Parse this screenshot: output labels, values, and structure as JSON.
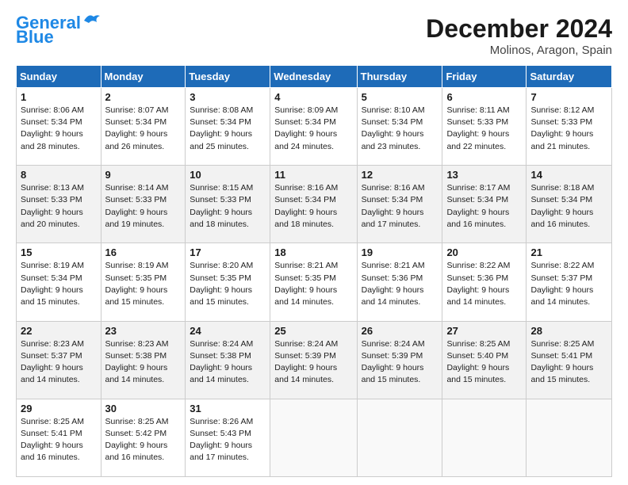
{
  "header": {
    "logo_line1": "General",
    "logo_line2": "Blue",
    "month_title": "December 2024",
    "location": "Molinos, Aragon, Spain"
  },
  "weekdays": [
    "Sunday",
    "Monday",
    "Tuesday",
    "Wednesday",
    "Thursday",
    "Friday",
    "Saturday"
  ],
  "weeks": [
    [
      {
        "day": "1",
        "sunrise": "8:06 AM",
        "sunset": "5:34 PM",
        "daylight": "9 hours and 28 minutes."
      },
      {
        "day": "2",
        "sunrise": "8:07 AM",
        "sunset": "5:34 PM",
        "daylight": "9 hours and 26 minutes."
      },
      {
        "day": "3",
        "sunrise": "8:08 AM",
        "sunset": "5:34 PM",
        "daylight": "9 hours and 25 minutes."
      },
      {
        "day": "4",
        "sunrise": "8:09 AM",
        "sunset": "5:34 PM",
        "daylight": "9 hours and 24 minutes."
      },
      {
        "day": "5",
        "sunrise": "8:10 AM",
        "sunset": "5:34 PM",
        "daylight": "9 hours and 23 minutes."
      },
      {
        "day": "6",
        "sunrise": "8:11 AM",
        "sunset": "5:33 PM",
        "daylight": "9 hours and 22 minutes."
      },
      {
        "day": "7",
        "sunrise": "8:12 AM",
        "sunset": "5:33 PM",
        "daylight": "9 hours and 21 minutes."
      }
    ],
    [
      {
        "day": "8",
        "sunrise": "8:13 AM",
        "sunset": "5:33 PM",
        "daylight": "9 hours and 20 minutes."
      },
      {
        "day": "9",
        "sunrise": "8:14 AM",
        "sunset": "5:33 PM",
        "daylight": "9 hours and 19 minutes."
      },
      {
        "day": "10",
        "sunrise": "8:15 AM",
        "sunset": "5:33 PM",
        "daylight": "9 hours and 18 minutes."
      },
      {
        "day": "11",
        "sunrise": "8:16 AM",
        "sunset": "5:34 PM",
        "daylight": "9 hours and 18 minutes."
      },
      {
        "day": "12",
        "sunrise": "8:16 AM",
        "sunset": "5:34 PM",
        "daylight": "9 hours and 17 minutes."
      },
      {
        "day": "13",
        "sunrise": "8:17 AM",
        "sunset": "5:34 PM",
        "daylight": "9 hours and 16 minutes."
      },
      {
        "day": "14",
        "sunrise": "8:18 AM",
        "sunset": "5:34 PM",
        "daylight": "9 hours and 16 minutes."
      }
    ],
    [
      {
        "day": "15",
        "sunrise": "8:19 AM",
        "sunset": "5:34 PM",
        "daylight": "9 hours and 15 minutes."
      },
      {
        "day": "16",
        "sunrise": "8:19 AM",
        "sunset": "5:35 PM",
        "daylight": "9 hours and 15 minutes."
      },
      {
        "day": "17",
        "sunrise": "8:20 AM",
        "sunset": "5:35 PM",
        "daylight": "9 hours and 15 minutes."
      },
      {
        "day": "18",
        "sunrise": "8:21 AM",
        "sunset": "5:35 PM",
        "daylight": "9 hours and 14 minutes."
      },
      {
        "day": "19",
        "sunrise": "8:21 AM",
        "sunset": "5:36 PM",
        "daylight": "9 hours and 14 minutes."
      },
      {
        "day": "20",
        "sunrise": "8:22 AM",
        "sunset": "5:36 PM",
        "daylight": "9 hours and 14 minutes."
      },
      {
        "day": "21",
        "sunrise": "8:22 AM",
        "sunset": "5:37 PM",
        "daylight": "9 hours and 14 minutes."
      }
    ],
    [
      {
        "day": "22",
        "sunrise": "8:23 AM",
        "sunset": "5:37 PM",
        "daylight": "9 hours and 14 minutes."
      },
      {
        "day": "23",
        "sunrise": "8:23 AM",
        "sunset": "5:38 PM",
        "daylight": "9 hours and 14 minutes."
      },
      {
        "day": "24",
        "sunrise": "8:24 AM",
        "sunset": "5:38 PM",
        "daylight": "9 hours and 14 minutes."
      },
      {
        "day": "25",
        "sunrise": "8:24 AM",
        "sunset": "5:39 PM",
        "daylight": "9 hours and 14 minutes."
      },
      {
        "day": "26",
        "sunrise": "8:24 AM",
        "sunset": "5:39 PM",
        "daylight": "9 hours and 15 minutes."
      },
      {
        "day": "27",
        "sunrise": "8:25 AM",
        "sunset": "5:40 PM",
        "daylight": "9 hours and 15 minutes."
      },
      {
        "day": "28",
        "sunrise": "8:25 AM",
        "sunset": "5:41 PM",
        "daylight": "9 hours and 15 minutes."
      }
    ],
    [
      {
        "day": "29",
        "sunrise": "8:25 AM",
        "sunset": "5:41 PM",
        "daylight": "9 hours and 16 minutes."
      },
      {
        "day": "30",
        "sunrise": "8:25 AM",
        "sunset": "5:42 PM",
        "daylight": "9 hours and 16 minutes."
      },
      {
        "day": "31",
        "sunrise": "8:26 AM",
        "sunset": "5:43 PM",
        "daylight": "9 hours and 17 minutes."
      },
      null,
      null,
      null,
      null
    ]
  ]
}
